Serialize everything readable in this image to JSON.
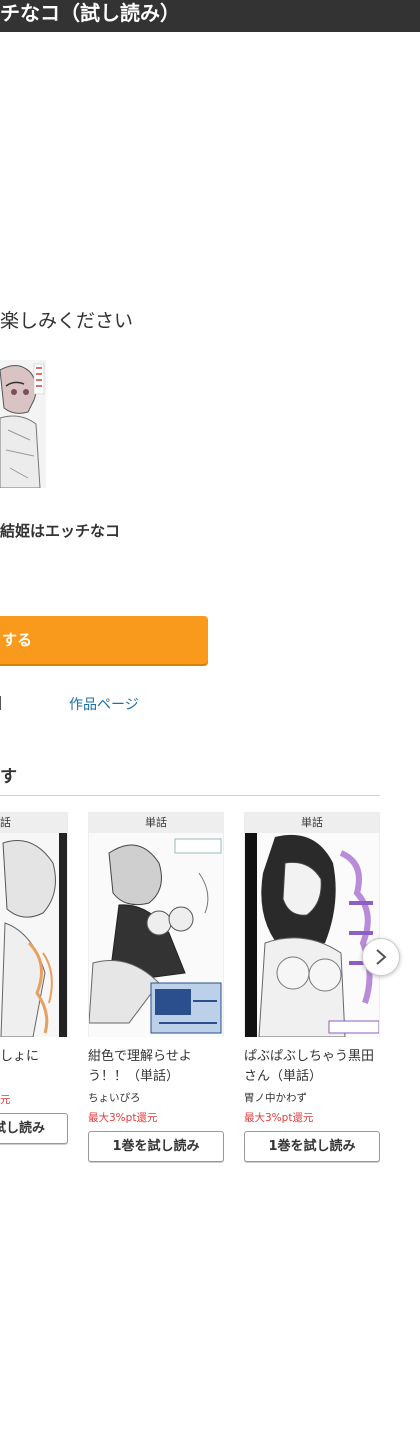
{
  "header": {
    "title": "チなコ（試し読み）"
  },
  "intro": {
    "message": "楽しみください"
  },
  "book": {
    "title": "結姫はエッチなコ"
  },
  "actions": {
    "primary_label": "する",
    "work_page_link": "作品ページ"
  },
  "section": {
    "heading": "す"
  },
  "carousel": {
    "items": [
      {
        "badge": "単話",
        "title": "しょに",
        "author": "",
        "reward": "元",
        "button": "試し読み"
      },
      {
        "badge": "単話",
        "title": "紺色で理解らせよう！！（単話）",
        "author": "ちょいぴろ",
        "reward": "最大3%pt還元",
        "button": "1巻を試し読み"
      },
      {
        "badge": "単話",
        "title": "ぱぶぱぶしちゃう黒田さん（単話）",
        "author": "胃ノ中かわず",
        "reward": "最大3%pt還元",
        "button": "1巻を試し読み"
      }
    ]
  },
  "colors": {
    "accent": "#f99a1c",
    "link": "#1a6fa8",
    "reward": "#e03c3c",
    "header_bg": "#333333"
  }
}
